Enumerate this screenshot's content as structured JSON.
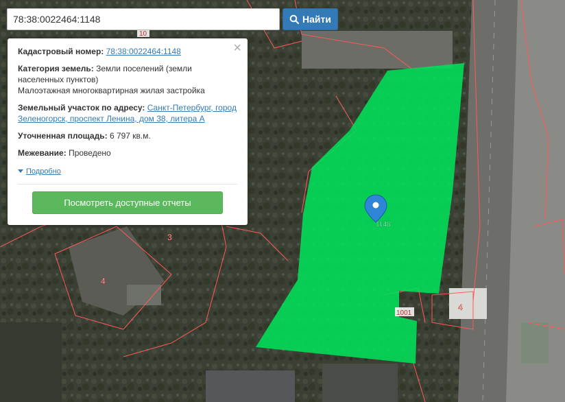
{
  "search": {
    "value": "78:38:0022464:1148",
    "button_label": "Найти"
  },
  "info_panel": {
    "cadastral_label": "Кадастровый номер:",
    "cadastral_value": "78:38:0022464:1148",
    "category_label": "Категория земель:",
    "category_value": "Земли поселений (земли населенных пунктов)",
    "usage_value": "Малоэтажная многоквартирная жилая застройка",
    "address_label": "Земельный участок по адресу:",
    "address_value": "Санкт-Петербург, город Зеленогорск, проспект Ленина, дом 38, литера А",
    "area_label": "Уточненная площадь:",
    "area_value": "6 797 кв.м.",
    "survey_label": "Межевание:",
    "survey_value": "Проведено",
    "details_link": "Подробно",
    "reports_button": "Посмотреть доступные отчеты",
    "close_glyph": "×"
  },
  "map": {
    "parcel_color": "#00e05a",
    "boundary_color": "#ff5a5a",
    "marker_color": "#2f86d6",
    "labels": {
      "parcel": "1148",
      "l10": "10",
      "l3": "3",
      "l4_left": "4",
      "l4_right": "4",
      "l1001": "1001"
    }
  }
}
